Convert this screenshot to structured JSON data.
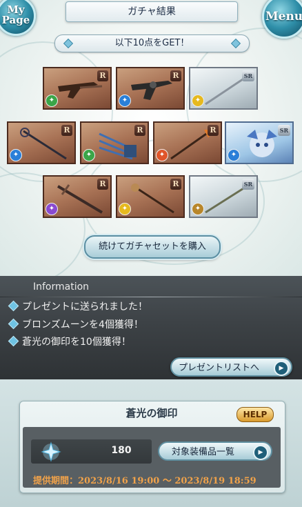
{
  "header": {
    "title": "ガチャ結果",
    "mypage_label": "My\nPage",
    "menu_label": "Menu"
  },
  "result_banner": {
    "text": "以下10点をGET！"
  },
  "items": [
    {
      "rarity": "R",
      "type": "gun",
      "element": "wind"
    },
    {
      "rarity": "R",
      "type": "gun",
      "element": "water"
    },
    {
      "rarity": "SR",
      "type": "spear",
      "element": "light"
    },
    {
      "rarity": "R",
      "type": "staff",
      "element": "water"
    },
    {
      "rarity": "R",
      "type": "claw",
      "element": "wind"
    },
    {
      "rarity": "R",
      "type": "staff",
      "element": "fire"
    },
    {
      "rarity": "SR",
      "type": "summon",
      "element": "water"
    },
    {
      "rarity": "R",
      "type": "sword",
      "element": "dark"
    },
    {
      "rarity": "R",
      "type": "staff",
      "element": "light"
    },
    {
      "rarity": "SR",
      "type": "spear",
      "element": "earth"
    }
  ],
  "buy_button": {
    "label": "続けてガチャセットを購入"
  },
  "information": {
    "title": "Information",
    "rows": [
      "プレゼントに送られました！",
      "ブロンズムーンを4個獲得！",
      "蒼光の御印を10個獲得！"
    ],
    "present_button": "プレゼントリストへ"
  },
  "seal": {
    "title": "蒼光の御印",
    "help": "HELP",
    "count": "180",
    "equip_button": "対象装備品一覧",
    "period": "提供期間：2023/8/16 19:00 ～ 2023/8/19 18:59"
  },
  "colors": {
    "wind": "#3aa548",
    "water": "#2a7fd8",
    "light": "#e6b91e",
    "fire": "#e0552a",
    "dark": "#8a4ad0",
    "earth": "#b8862a",
    "accent": "#f0a24a"
  }
}
